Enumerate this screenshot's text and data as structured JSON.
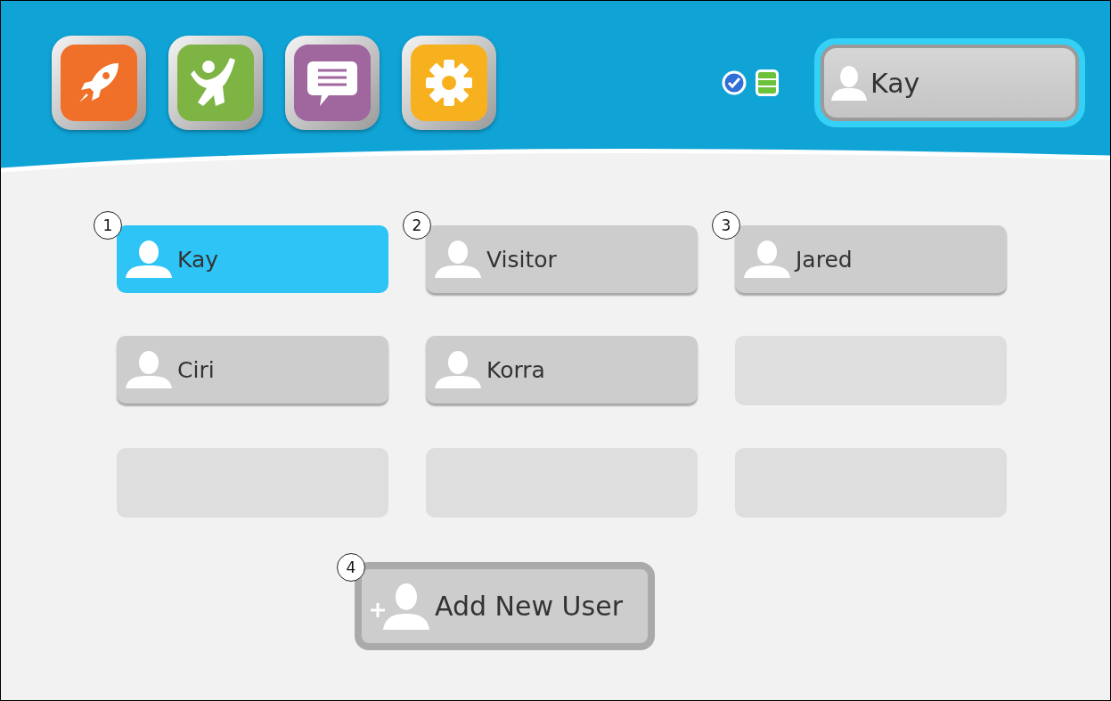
{
  "current_user": {
    "name": "Kay"
  },
  "user_slots": [
    {
      "kind": "user",
      "name": "Kay",
      "selected": true,
      "callout": "1"
    },
    {
      "kind": "user",
      "name": "Visitor",
      "selected": false,
      "callout": "2"
    },
    {
      "kind": "user",
      "name": "Jared",
      "selected": false,
      "callout": "3"
    },
    {
      "kind": "user",
      "name": "Ciri",
      "selected": false
    },
    {
      "kind": "user",
      "name": "Korra",
      "selected": false
    },
    {
      "kind": "empty"
    },
    {
      "kind": "empty"
    },
    {
      "kind": "empty"
    },
    {
      "kind": "empty"
    }
  ],
  "add_user_button": {
    "label": "Add New User",
    "callout": "4"
  }
}
